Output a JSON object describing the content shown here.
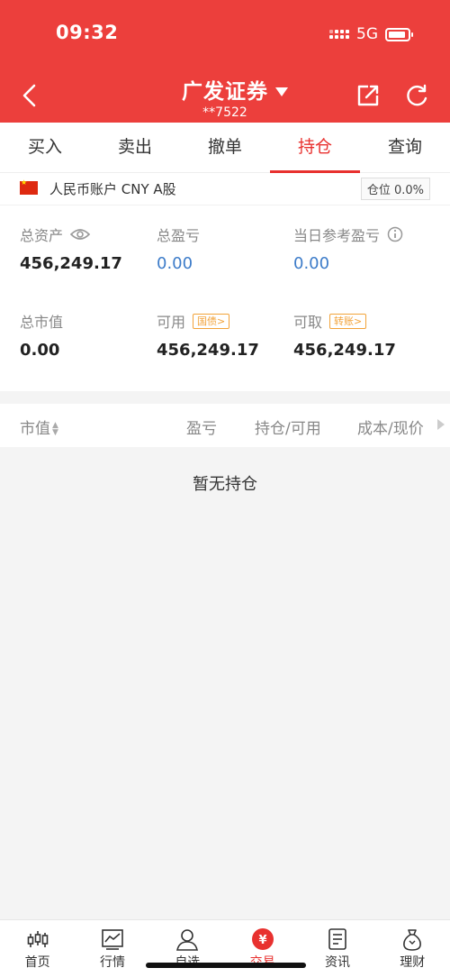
{
  "status_bar": {
    "time": "09:32",
    "network": "5G"
  },
  "header": {
    "title": "广发证券",
    "account_mask": "**7522"
  },
  "tabs": [
    {
      "label": "买入"
    },
    {
      "label": "卖出"
    },
    {
      "label": "撤单"
    },
    {
      "label": "持仓",
      "active": true
    },
    {
      "label": "查询"
    }
  ],
  "account": {
    "label": "人民币账户 CNY A股",
    "position_ratio": "仓位 0.0%"
  },
  "assets": {
    "total_assets": {
      "label": "总资产",
      "value": "456,249.17"
    },
    "total_pnl": {
      "label": "总盈亏",
      "value": "0.00"
    },
    "daily_pnl": {
      "label": "当日参考盈亏",
      "value": "0.00"
    },
    "market_value": {
      "label": "总市值",
      "value": "0.00"
    },
    "available": {
      "label": "可用",
      "tag": "国债>",
      "value": "456,249.17"
    },
    "withdrawable": {
      "label": "可取",
      "tag": "转账>",
      "value": "456,249.17"
    }
  },
  "table": {
    "headers": {
      "market_value": "市值",
      "pnl": "盈亏",
      "holding": "持仓/可用",
      "cost": "成本/现价"
    },
    "empty_message": "暂无持仓"
  },
  "bottom_nav": [
    {
      "label": "首页",
      "icon": "candlestick-icon"
    },
    {
      "label": "行情",
      "icon": "chart-icon"
    },
    {
      "label": "自选",
      "icon": "person-icon"
    },
    {
      "label": "交易",
      "icon": "yuan-icon",
      "active": true
    },
    {
      "label": "资讯",
      "icon": "document-icon"
    },
    {
      "label": "理财",
      "icon": "moneybag-icon"
    }
  ],
  "colors": {
    "brand_red": "#ec3f3c",
    "active_red": "#e8312f",
    "value_blue": "#3d7cc9",
    "tag_orange": "#f2a33a"
  }
}
